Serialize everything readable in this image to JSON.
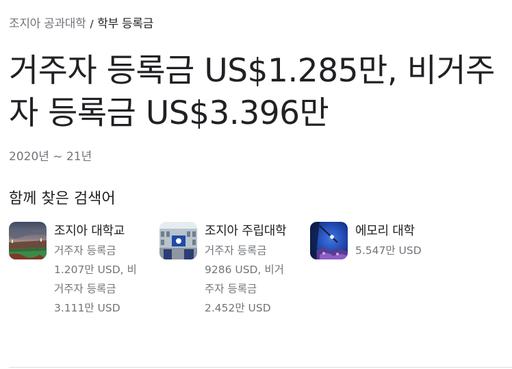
{
  "breadcrumb": {
    "parent": "조지아 공과대학",
    "separator": "/",
    "current": "학부 등록금"
  },
  "answer": {
    "title": "거주자 등록금 US$1.285만, 비거주자 등록금 US$3.396만",
    "subtitle": "2020년 ~ 21년"
  },
  "related": {
    "heading": "함께 찾은 검색어",
    "items": [
      {
        "name": "조지아 대학교",
        "detail": "거주자 등록금 1.207만 USD, 비거주자 등록금 3.111만 USD"
      },
      {
        "name": "조지아 주립대학",
        "detail": "거주자 등록금 9286 USD, 비거주자 등록금 2.452만 USD"
      },
      {
        "name": "에모리 대학",
        "detail": "5.547만 USD"
      }
    ]
  }
}
